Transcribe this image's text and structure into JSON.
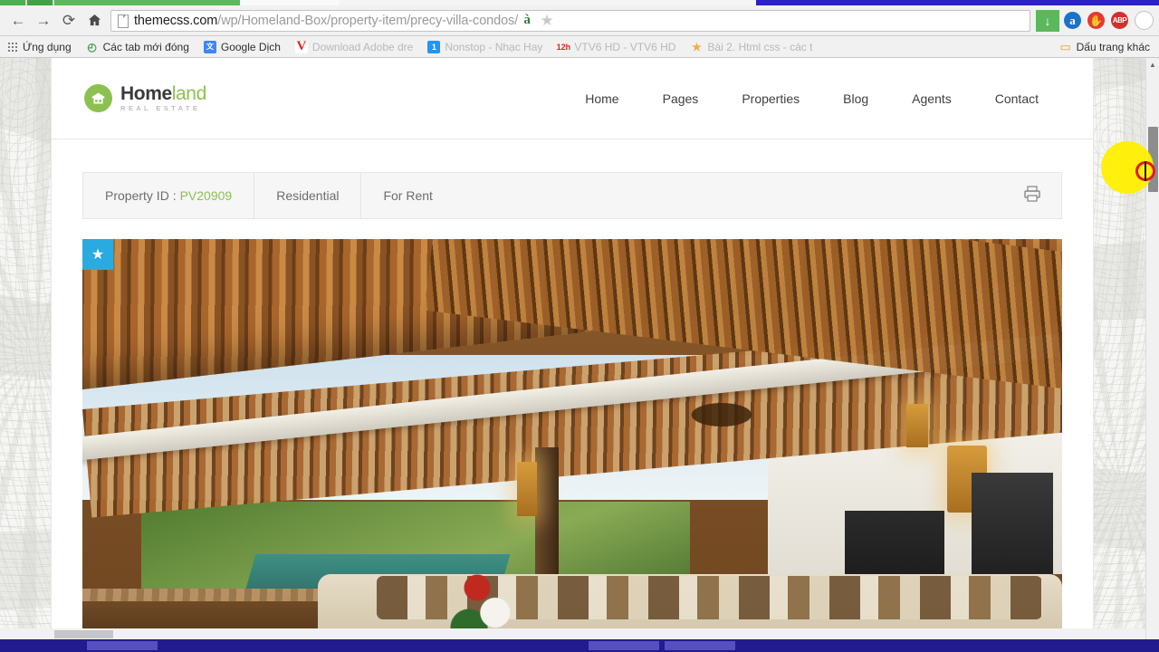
{
  "browser": {
    "nav": {
      "back_label": "←",
      "forward_label": "→",
      "reload_label": "⟳",
      "home_label": "home-icon"
    },
    "omnibox": {
      "host": "themecss.com",
      "path": "/wp/Homeland-Box/property-item/precy-villa-condos/",
      "translate_icon": "à",
      "bookmark_star_icon": "★",
      "download_icon": "↓"
    },
    "extensions": [
      {
        "name": "amazon-assistant",
        "label": "a"
      },
      {
        "name": "blocker-stop",
        "label": "✋"
      },
      {
        "name": "adblock-plus",
        "label": "ABP"
      },
      {
        "name": "profile-avatar",
        "label": ""
      }
    ],
    "bookmarks": [
      {
        "label": "Ứng dụng",
        "icon": "apps-grid-icon",
        "faded": false
      },
      {
        "label": "Các tab mới đóng",
        "icon": "recent-tabs-icon",
        "faded": false
      },
      {
        "label": "Google Dịch",
        "icon": "google-translate-icon",
        "faded": false
      },
      {
        "label": "Download Adobe dre",
        "icon": "adobe-icon",
        "faded": true
      },
      {
        "label": "Nonstop - Nhạc Hay",
        "icon": "blue-one-icon",
        "faded": true
      },
      {
        "label": "VTV6 HD - VTV6 HD",
        "icon": "12h-icon",
        "faded": true
      },
      {
        "label": "Bài 2. Html css - các t",
        "icon": "star-bookmark-icon",
        "faded": true
      }
    ],
    "bookmarks_right": {
      "label": "Dấu trang khác",
      "icon": "folder-icon"
    }
  },
  "site": {
    "logo": {
      "name_dark": "Home",
      "name_light": "land",
      "tagline": "REAL ESTATE",
      "mark_icon": "house-badge-icon"
    },
    "nav": [
      {
        "label": "Home"
      },
      {
        "label": "Pages"
      },
      {
        "label": "Properties"
      },
      {
        "label": "Blog"
      },
      {
        "label": "Agents"
      },
      {
        "label": "Contact"
      }
    ]
  },
  "property": {
    "id_label": "Property ID :",
    "id_value": "PV20909",
    "type": "Residential",
    "status": "For Rent",
    "print_icon": "printer-icon",
    "featured_badge_icon": "★"
  },
  "colors": {
    "brand_green": "#8cc152",
    "badge_blue": "#29abe2",
    "taskbar_blue": "#221b8f",
    "click_highlight": "#ffef00",
    "click_ring": "#e01b1b"
  },
  "scroll": {
    "up_arrow": "▲",
    "down_arrow": "▼"
  }
}
